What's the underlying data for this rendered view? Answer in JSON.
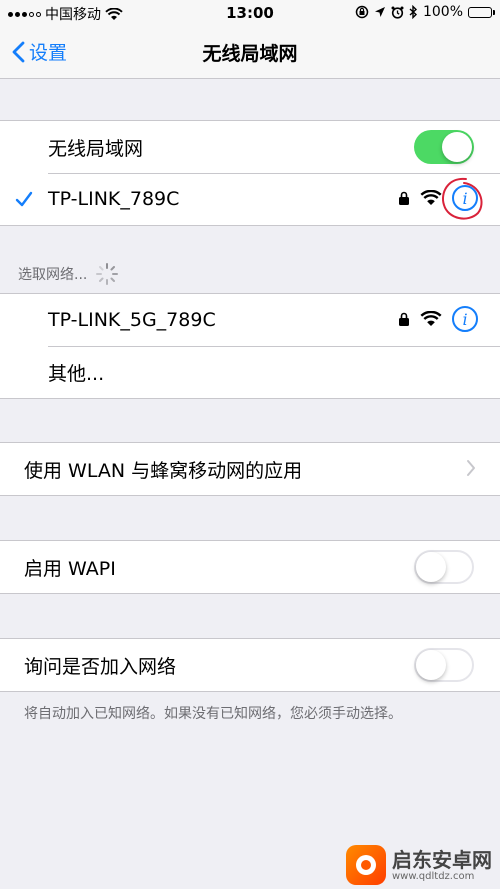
{
  "status_bar": {
    "carrier": "中国移动",
    "time": "13:00",
    "battery": "100%",
    "battery_level": 1.0,
    "icons": [
      "signal-icon",
      "wifi-icon",
      "orientation-lock-icon",
      "location-icon",
      "alarm-icon",
      "bluetooth-icon",
      "battery-icon"
    ]
  },
  "nav": {
    "back_label": "设置",
    "title": "无线局域网"
  },
  "wifi_group": {
    "toggle_label": "无线局域网",
    "toggle_on": true,
    "connected_network": "TP-LINK_789C"
  },
  "choose_header": "选取网络...",
  "networks": [
    {
      "name": "TP-LINK_5G_789C"
    }
  ],
  "other_label": "其他...",
  "wlan_apps_label": "使用 WLAN 与蜂窝移动网的应用",
  "wapi": {
    "label": "启用 WAPI",
    "on": false
  },
  "ask_join": {
    "label": "询问是否加入网络",
    "on": false
  },
  "ask_join_footer": "将自动加入已知网络。如果没有已知网络，您必须手动选择。",
  "watermark": {
    "title": "启东安卓网",
    "url": "www.qdltdz.com"
  },
  "colors": {
    "accent": "#147efb",
    "toggle_on": "#4cd964",
    "background": "#efeff4"
  }
}
